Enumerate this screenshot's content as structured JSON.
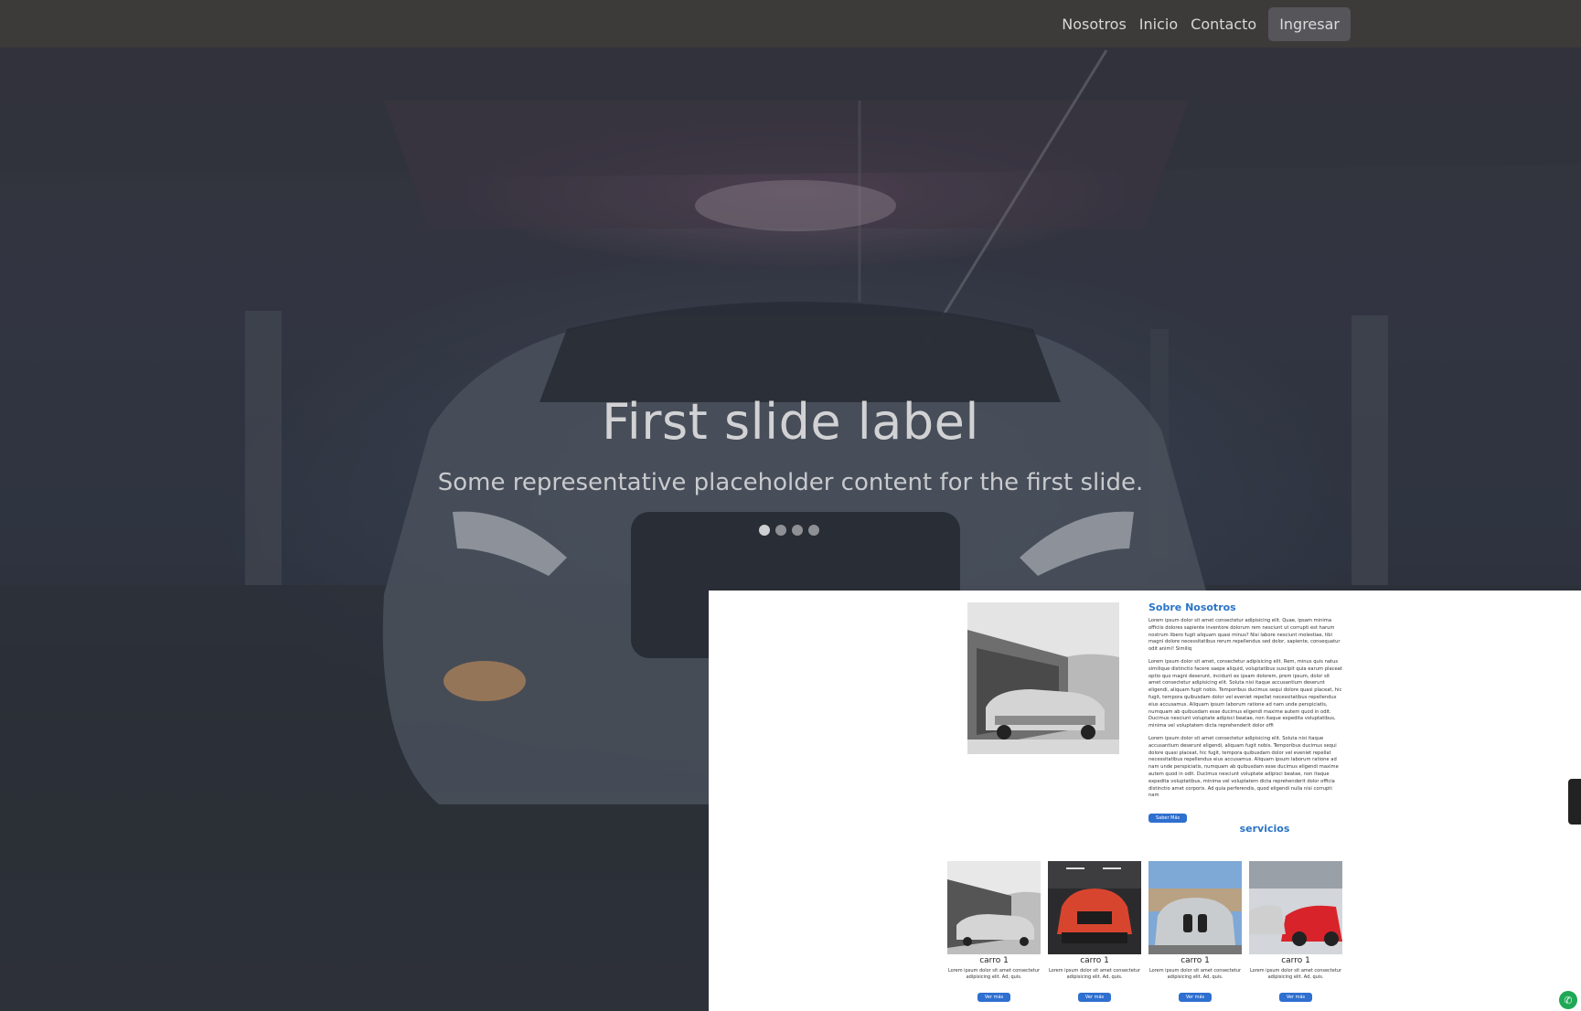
{
  "nav": {
    "links": [
      "Nosotros",
      "Inicio",
      "Contacto"
    ],
    "login_label": "Ingresar"
  },
  "carousel": {
    "title": "First slide label",
    "text": "Some representative placeholder content for the first slide.",
    "indicator_count": 4,
    "active_index": 0
  },
  "about": {
    "title": "Sobre Nosotros",
    "paragraphs": [
      "Lorem ipsum dolor sit amet consectetur adipisicing elit. Quae, ipsam minima officiis dolores sapiente inventore dolorum rem nesciunt ut corrupti est harum nostrum libero fugit aliquam quasi minus? Nisi labore nesciunt molestiae, tibi magni dolore necessitatibus rerum repellendus sed dolor, sapiente, consequatur odit animi! Similiq",
      "Lorem ipsum dolor sit amet, consectetur adipisicing elit. Rem, minus quis natus similique distinctio facere saepe aliquid, voluptatibus suscipit quia earum placeat optio quo magni deserunt, incidunt ex ipsam dolorem, prem ipsum, dolor sit amet consectetur adipisicing elit. Soluta nisi itaque accusantium deserunt eligendi, aliquam fugit nobis. Temporibus ducimus sequi dolore quasi placeat, hic fugit, tempora quibusdam dolor vel eveniet repellat necessitatibus repellendus eius accusamus. Aliquam ipsum laborum ratione ad nam unde perspiciatis, numquam ab quibusdam esse ducimus eligendi maxime autem quod in odit. Ducimus nesciunt voluptate adipisci beatae, non itaque expedita voluptatibus, minima vel voluptatem dicta reprehenderit dolor offi",
      "Lorem ipsum dolor sit amet consectetur adipisicing elit. Soluta nisi itaque accusantium deserunt eligendi, aliquam fugit nobis. Temporibus ducimus sequi dolore quasi placeat, hic fugit, tempora quibusdam dolor vel eveniet repellat necessitatibus repellendus eius accusamus. Aliquam ipsum laborum ratione ad nam unde perspiciatis, numquam ab quibusdam esse ducimus eligendi maxime autem quod in odit. Ducimus nesciunt voluptate adipisci beatae, non itaque expedita voluptatibus, minima vel voluptatem dicta reprehenderit dolor officia distinctio amet corporis. Ad quia perferendis, quod eligendi nulla nisi corrupti nam"
    ],
    "button_label": "Saber Más"
  },
  "services": {
    "title": "servicios",
    "cards": [
      {
        "title": "carro 1",
        "text": "Lorem ipsum dolor sit amet consectetur adipisicing elit. Ad, quis.",
        "button": "Ver más"
      },
      {
        "title": "carro 1",
        "text": "Lorem ipsum dolor sit amet consectetur adipisicing elit. Ad, quis.",
        "button": "Ver más"
      },
      {
        "title": "carro 1",
        "text": "Lorem ipsum dolor sit amet consectetur adipisicing elit. Ad, quis.",
        "button": "Ver más"
      },
      {
        "title": "carro 1",
        "text": "Lorem ipsum dolor sit amet consectetur adipisicing elit. Ad, quis.",
        "button": "Ver más"
      }
    ]
  },
  "icons": {
    "whatsapp": "whatsapp-icon",
    "side_widget": "feedback-tab"
  }
}
